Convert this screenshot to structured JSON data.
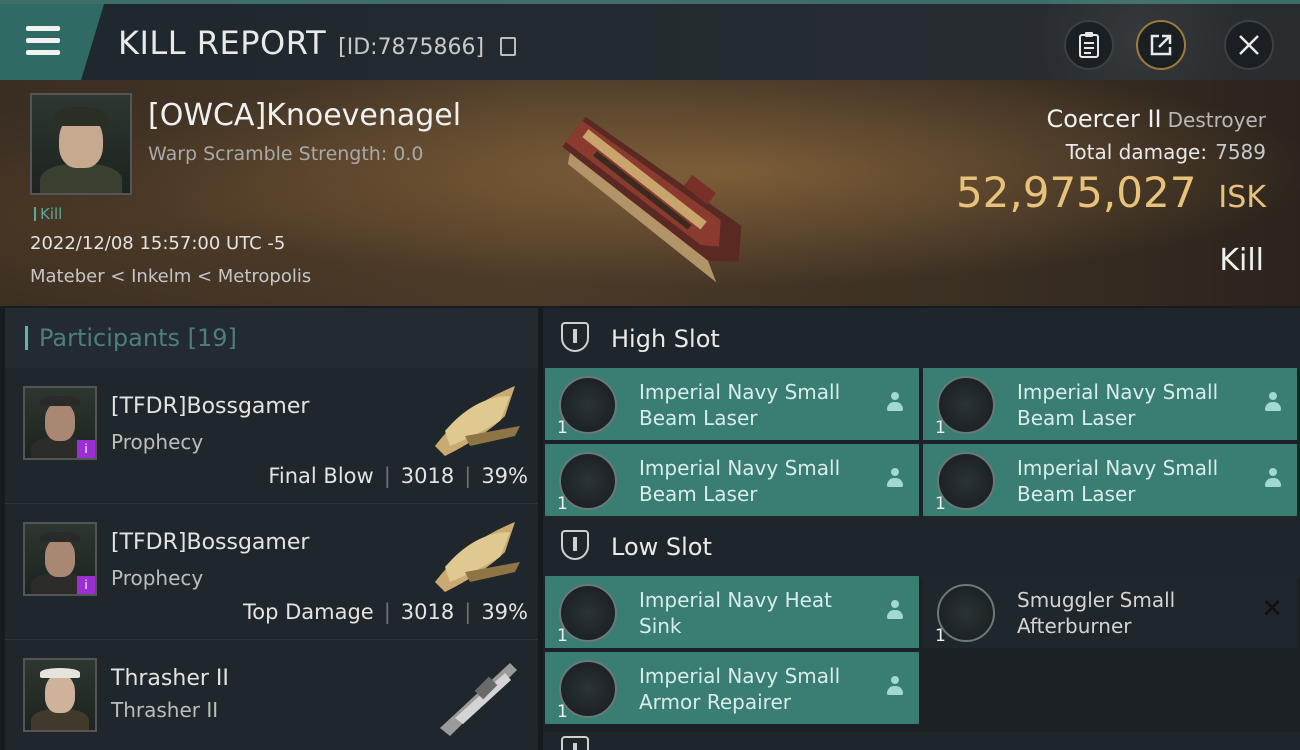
{
  "header": {
    "title": "KILL REPORT",
    "report_id": "[ID:7875866]",
    "buttons": {
      "clipboard": "clipboard-icon",
      "share": "share-icon",
      "close": "close-icon"
    }
  },
  "victim": {
    "name": "[OWCA]Knoevenagel",
    "warp_scramble": "Warp Scramble Strength: 0.0",
    "tag": "Kill",
    "datetime": "2022/12/08 15:57:00 UTC -5",
    "location": "Mateber < Inkelm < Metropolis",
    "ship_name": "Coercer II",
    "ship_class": "Destroyer",
    "total_damage_label": "Total damage:",
    "total_damage": "7589",
    "isk_value": "52,975,027",
    "isk_unit": "ISK",
    "kill_type": "Kill"
  },
  "participants": {
    "label": "Participants",
    "count": "[19]",
    "rows": [
      {
        "name": "[TFDR]Bossgamer",
        "ship": "Prophecy",
        "role": "Final Blow",
        "damage": "3018",
        "percent": "39%",
        "badge": "i"
      },
      {
        "name": "[TFDR]Bossgamer",
        "ship": "Prophecy",
        "role": "Top Damage",
        "damage": "3018",
        "percent": "39%",
        "badge": "i"
      },
      {
        "name": "Thrasher II",
        "ship": "Thrasher II"
      }
    ]
  },
  "fittings": {
    "high_slot_label": "High Slot",
    "low_slot_label": "Low Slot",
    "high": [
      {
        "name": "Imperial Navy Small Beam Laser",
        "qty": "1"
      },
      {
        "name": "Imperial Navy Small Beam Laser",
        "qty": "1"
      },
      {
        "name": "Imperial Navy Small Beam Laser",
        "qty": "1"
      },
      {
        "name": "Imperial Navy Small Beam Laser",
        "qty": "1"
      }
    ],
    "low": [
      {
        "name": "Imperial Navy Heat Sink",
        "qty": "1"
      },
      {
        "name": "Smuggler Small Afterburner",
        "qty": "1"
      },
      {
        "name": "Imperial Navy Small Armor Repairer",
        "qty": "1"
      }
    ]
  },
  "colors": {
    "accent": "#3a7d73",
    "isk": "#e7c27a",
    "badge": "#9b2fd3"
  }
}
